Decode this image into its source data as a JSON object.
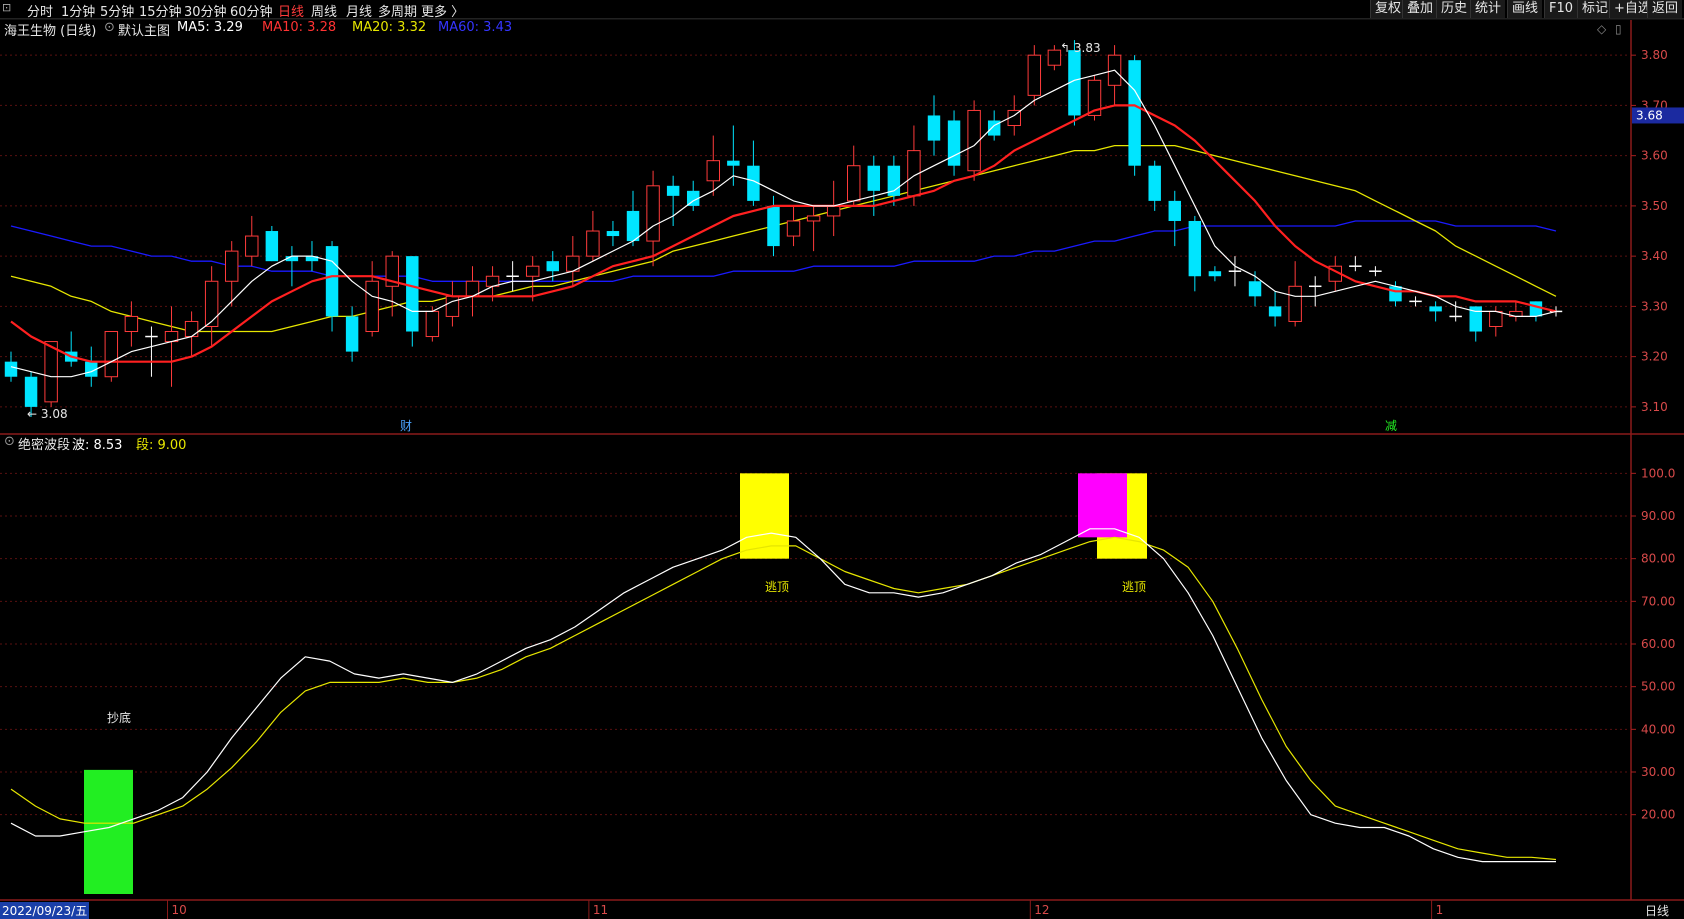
{
  "toolbar": {
    "timeframes": [
      "分时",
      "1分钟",
      "5分钟",
      "15分钟",
      "30分钟",
      "60分钟",
      "日线",
      "周线",
      "月线",
      "多周期",
      "更多 〉"
    ],
    "active": "日线",
    "right_buttons": [
      "复权",
      "叠加",
      "历史",
      "统计",
      "画线",
      "F10",
      "标记",
      "+自选",
      "返回"
    ]
  },
  "main_header": {
    "stock": "海王生物 (日线)",
    "template": "默认主图",
    "ma5": "MA5: 3.29",
    "ma10": "MA10: 3.28",
    "ma20": "MA20: 3.32",
    "ma60": "MA60: 3.43"
  },
  "sub_header": {
    "indicator": "绝密波段",
    "wave": "波: 8.53",
    "segment": "段: 9.00"
  },
  "price_axis": [
    "3.80",
    "3.70",
    "3.60",
    "3.50",
    "3.40",
    "3.30",
    "3.20",
    "3.10"
  ],
  "current_price": "3.68",
  "indicator_axis": [
    "100.0",
    "90.00",
    "80.00",
    "70.00",
    "60.00",
    "50.00",
    "40.00",
    "30.00",
    "20.00"
  ],
  "annotations": {
    "high": "3.83",
    "low": "3.08",
    "cai": "财",
    "jian": "减",
    "buy": "抄底",
    "sell1": "逃顶",
    "sell2": "逃顶"
  },
  "x_axis": {
    "date": "2022/09/23/五",
    "months": [
      "10",
      "11",
      "12",
      "1"
    ],
    "period": "日线"
  },
  "colors": {
    "up": "#ff3b3b",
    "down": "#00e5ff",
    "ma5": "#ffffff",
    "ma10": "#ff2020",
    "ma20": "#e6e600",
    "ma60": "#1a1aff",
    "wave": "#ffffff",
    "segment": "#e6e600",
    "buy_bar": "#22ee22",
    "sell_bar": "#ffff00",
    "warn_bar": "#ff00ff"
  },
  "chart_data": {
    "type": "candlestick",
    "price_ylim": [
      3.05,
      3.87
    ],
    "candles": [
      [
        3.19,
        3.16,
        3.21,
        3.15
      ],
      [
        3.16,
        3.1,
        3.17,
        3.08
      ],
      [
        3.11,
        3.23,
        3.23,
        3.1
      ],
      [
        3.21,
        3.19,
        3.25,
        3.18
      ],
      [
        3.19,
        3.16,
        3.22,
        3.14
      ],
      [
        3.16,
        3.25,
        3.25,
        3.15
      ],
      [
        3.25,
        3.28,
        3.31,
        3.22
      ],
      [
        3.24,
        3.24,
        3.26,
        3.16
      ],
      [
        3.23,
        3.25,
        3.3,
        3.14
      ],
      [
        3.24,
        3.27,
        3.29,
        3.2
      ],
      [
        3.26,
        3.35,
        3.38,
        3.22
      ],
      [
        3.35,
        3.41,
        3.43,
        3.3
      ],
      [
        3.4,
        3.44,
        3.48,
        3.38
      ],
      [
        3.45,
        3.39,
        3.46,
        3.39
      ],
      [
        3.4,
        3.39,
        3.42,
        3.34
      ],
      [
        3.4,
        3.39,
        3.43,
        3.37
      ],
      [
        3.42,
        3.28,
        3.43,
        3.25
      ],
      [
        3.28,
        3.21,
        3.3,
        3.19
      ],
      [
        3.25,
        3.35,
        3.39,
        3.24
      ],
      [
        3.34,
        3.4,
        3.41,
        3.28
      ],
      [
        3.4,
        3.25,
        3.4,
        3.22
      ],
      [
        3.24,
        3.29,
        3.3,
        3.23
      ],
      [
        3.28,
        3.32,
        3.35,
        3.26
      ],
      [
        3.32,
        3.35,
        3.38,
        3.28
      ],
      [
        3.34,
        3.36,
        3.38,
        3.31
      ],
      [
        3.36,
        3.36,
        3.39,
        3.33
      ],
      [
        3.36,
        3.38,
        3.4,
        3.31
      ],
      [
        3.39,
        3.37,
        3.41,
        3.35
      ],
      [
        3.37,
        3.4,
        3.44,
        3.34
      ],
      [
        3.4,
        3.45,
        3.49,
        3.39
      ],
      [
        3.45,
        3.44,
        3.47,
        3.42
      ],
      [
        3.49,
        3.43,
        3.53,
        3.42
      ],
      [
        3.43,
        3.54,
        3.57,
        3.38
      ],
      [
        3.54,
        3.52,
        3.56,
        3.46
      ],
      [
        3.53,
        3.5,
        3.55,
        3.49
      ],
      [
        3.55,
        3.59,
        3.64,
        3.52
      ],
      [
        3.59,
        3.58,
        3.66,
        3.54
      ],
      [
        3.58,
        3.51,
        3.63,
        3.5
      ],
      [
        3.5,
        3.42,
        3.52,
        3.4
      ],
      [
        3.44,
        3.47,
        3.5,
        3.42
      ],
      [
        3.47,
        3.48,
        3.5,
        3.41
      ],
      [
        3.48,
        3.5,
        3.55,
        3.44
      ],
      [
        3.51,
        3.58,
        3.62,
        3.5
      ],
      [
        3.58,
        3.53,
        3.6,
        3.48
      ],
      [
        3.58,
        3.52,
        3.6,
        3.5
      ],
      [
        3.52,
        3.61,
        3.66,
        3.5
      ],
      [
        3.68,
        3.63,
        3.72,
        3.6
      ],
      [
        3.67,
        3.58,
        3.69,
        3.56
      ],
      [
        3.57,
        3.69,
        3.71,
        3.55
      ],
      [
        3.67,
        3.64,
        3.69,
        3.63
      ],
      [
        3.66,
        3.69,
        3.72,
        3.64
      ],
      [
        3.72,
        3.8,
        3.82,
        3.7
      ],
      [
        3.78,
        3.81,
        3.82,
        3.77
      ],
      [
        3.81,
        3.68,
        3.83,
        3.66
      ],
      [
        3.68,
        3.75,
        3.76,
        3.67
      ],
      [
        3.74,
        3.8,
        3.82,
        3.7
      ],
      [
        3.79,
        3.58,
        3.8,
        3.56
      ],
      [
        3.58,
        3.51,
        3.59,
        3.49
      ],
      [
        3.51,
        3.47,
        3.53,
        3.42
      ],
      [
        3.47,
        3.36,
        3.48,
        3.33
      ],
      [
        3.37,
        3.36,
        3.38,
        3.35
      ],
      [
        3.37,
        3.37,
        3.4,
        3.34
      ],
      [
        3.35,
        3.32,
        3.37,
        3.3
      ],
      [
        3.3,
        3.28,
        3.33,
        3.26
      ],
      [
        3.27,
        3.34,
        3.39,
        3.26
      ],
      [
        3.34,
        3.34,
        3.36,
        3.3
      ],
      [
        3.35,
        3.38,
        3.4,
        3.33
      ],
      [
        3.38,
        3.38,
        3.4,
        3.37
      ],
      [
        3.37,
        3.37,
        3.38,
        3.36
      ],
      [
        3.34,
        3.31,
        3.35,
        3.3
      ],
      [
        3.31,
        3.31,
        3.32,
        3.3
      ],
      [
        3.3,
        3.29,
        3.31,
        3.27
      ],
      [
        3.28,
        3.28,
        3.31,
        3.27
      ],
      [
        3.3,
        3.25,
        3.3,
        3.23
      ],
      [
        3.26,
        3.29,
        3.3,
        3.24
      ],
      [
        3.28,
        3.29,
        3.31,
        3.27
      ],
      [
        3.31,
        3.28,
        3.31,
        3.27
      ],
      [
        3.29,
        3.29,
        3.3,
        3.28
      ]
    ],
    "ma5": [
      3.18,
      3.17,
      3.16,
      3.16,
      3.17,
      3.19,
      3.21,
      3.22,
      3.23,
      3.24,
      3.27,
      3.31,
      3.35,
      3.38,
      3.4,
      3.4,
      3.39,
      3.35,
      3.32,
      3.31,
      3.29,
      3.29,
      3.31,
      3.32,
      3.34,
      3.35,
      3.35,
      3.36,
      3.37,
      3.39,
      3.41,
      3.43,
      3.46,
      3.48,
      3.51,
      3.53,
      3.56,
      3.55,
      3.53,
      3.51,
      3.5,
      3.5,
      3.51,
      3.52,
      3.53,
      3.56,
      3.58,
      3.6,
      3.62,
      3.66,
      3.68,
      3.71,
      3.73,
      3.75,
      3.76,
      3.77,
      3.73,
      3.66,
      3.58,
      3.5,
      3.42,
      3.38,
      3.36,
      3.33,
      3.32,
      3.32,
      3.33,
      3.34,
      3.35,
      3.34,
      3.33,
      3.32,
      3.3,
      3.29,
      3.29,
      3.28,
      3.28,
      3.29
    ],
    "ma10": [
      3.27,
      3.24,
      3.22,
      3.2,
      3.19,
      3.19,
      3.19,
      3.19,
      3.19,
      3.2,
      3.22,
      3.25,
      3.28,
      3.31,
      3.33,
      3.35,
      3.36,
      3.36,
      3.36,
      3.35,
      3.34,
      3.33,
      3.32,
      3.32,
      3.32,
      3.32,
      3.32,
      3.33,
      3.34,
      3.36,
      3.38,
      3.39,
      3.4,
      3.42,
      3.44,
      3.46,
      3.48,
      3.49,
      3.5,
      3.5,
      3.5,
      3.5,
      3.5,
      3.5,
      3.51,
      3.52,
      3.53,
      3.55,
      3.56,
      3.58,
      3.61,
      3.63,
      3.65,
      3.67,
      3.69,
      3.7,
      3.7,
      3.68,
      3.66,
      3.63,
      3.59,
      3.55,
      3.51,
      3.46,
      3.42,
      3.39,
      3.37,
      3.35,
      3.34,
      3.33,
      3.33,
      3.32,
      3.32,
      3.31,
      3.31,
      3.31,
      3.3,
      3.29
    ],
    "ma20": [
      3.36,
      3.35,
      3.34,
      3.32,
      3.31,
      3.29,
      3.28,
      3.27,
      3.26,
      3.25,
      3.25,
      3.25,
      3.25,
      3.25,
      3.26,
      3.27,
      3.28,
      3.28,
      3.29,
      3.3,
      3.31,
      3.31,
      3.32,
      3.32,
      3.32,
      3.33,
      3.34,
      3.34,
      3.35,
      3.36,
      3.37,
      3.38,
      3.39,
      3.41,
      3.42,
      3.43,
      3.44,
      3.45,
      3.46,
      3.47,
      3.48,
      3.49,
      3.5,
      3.51,
      3.52,
      3.53,
      3.54,
      3.55,
      3.56,
      3.57,
      3.58,
      3.59,
      3.6,
      3.61,
      3.61,
      3.62,
      3.62,
      3.62,
      3.62,
      3.61,
      3.6,
      3.59,
      3.58,
      3.57,
      3.56,
      3.55,
      3.54,
      3.53,
      3.51,
      3.49,
      3.47,
      3.45,
      3.42,
      3.4,
      3.38,
      3.36,
      3.34,
      3.32
    ],
    "ma60": [
      3.46,
      3.45,
      3.44,
      3.43,
      3.42,
      3.42,
      3.41,
      3.4,
      3.4,
      3.39,
      3.39,
      3.38,
      3.38,
      3.37,
      3.37,
      3.37,
      3.36,
      3.36,
      3.36,
      3.36,
      3.36,
      3.35,
      3.35,
      3.35,
      3.35,
      3.35,
      3.35,
      3.35,
      3.35,
      3.35,
      3.35,
      3.36,
      3.36,
      3.36,
      3.36,
      3.36,
      3.37,
      3.37,
      3.37,
      3.37,
      3.38,
      3.38,
      3.38,
      3.38,
      3.38,
      3.39,
      3.39,
      3.39,
      3.39,
      3.4,
      3.4,
      3.41,
      3.41,
      3.42,
      3.43,
      3.43,
      3.44,
      3.45,
      3.45,
      3.46,
      3.46,
      3.46,
      3.46,
      3.46,
      3.46,
      3.46,
      3.46,
      3.47,
      3.47,
      3.47,
      3.47,
      3.47,
      3.46,
      3.46,
      3.46,
      3.46,
      3.46,
      3.45
    ],
    "indicator_ylim": [
      0,
      105
    ],
    "wave": [
      18,
      15,
      15,
      16,
      17,
      19,
      21,
      24,
      30,
      38,
      45,
      52,
      57,
      56,
      53,
      52,
      53,
      52,
      51,
      53,
      56,
      59,
      61,
      64,
      68,
      72,
      75,
      78,
      80,
      82,
      85,
      86,
      85,
      80,
      74,
      72,
      72,
      71,
      72,
      74,
      76,
      79,
      81,
      84,
      87,
      87,
      85,
      80,
      72,
      62,
      50,
      38,
      28,
      20,
      18,
      17,
      17,
      15,
      12,
      10,
      9,
      9,
      9,
      9
    ],
    "segment": [
      26,
      22,
      19,
      18,
      18,
      18,
      20,
      22,
      26,
      31,
      37,
      44,
      49,
      51,
      51,
      51,
      52,
      51,
      51,
      52,
      54,
      57,
      59,
      62,
      65,
      68,
      71,
      74,
      77,
      80,
      82,
      83,
      83,
      80,
      77,
      75,
      73,
      72,
      73,
      74,
      76,
      78,
      80,
      82,
      84,
      85,
      84,
      82,
      78,
      70,
      59,
      47,
      36,
      28,
      22,
      20,
      18,
      16,
      14,
      12,
      11,
      10,
      10,
      9.5
    ]
  }
}
